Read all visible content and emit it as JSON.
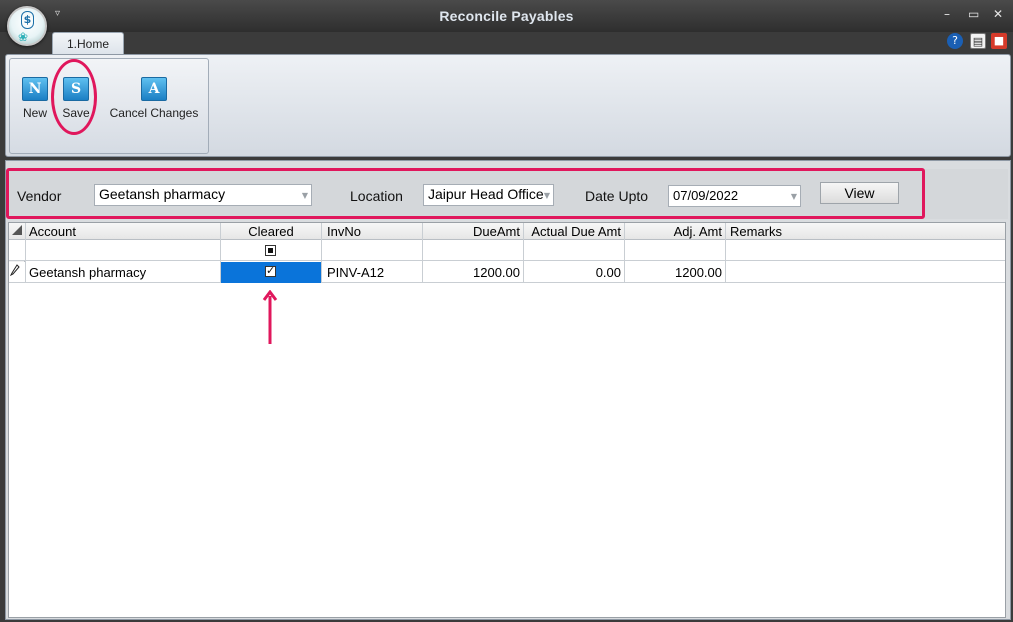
{
  "window": {
    "title": "Reconcile Payables",
    "minimize": "–",
    "restore": "▭",
    "close": "✕"
  },
  "tabs": [
    {
      "label": "1.Home"
    }
  ],
  "ribbon": {
    "buttons": [
      {
        "label": "New",
        "icon": "N"
      },
      {
        "label": "Save",
        "icon": "S"
      },
      {
        "label": "Cancel Changes",
        "icon": "A"
      }
    ]
  },
  "filters": {
    "vendor_label": "Vendor",
    "vendor_value": "Geetansh pharmacy",
    "location_label": "Location",
    "location_value": "Jaipur Head Office",
    "date_label": "Date Upto",
    "date_value": "07/09/2022",
    "view_label": "View"
  },
  "grid": {
    "columns": [
      "Account",
      "Cleared",
      "InvNo",
      "DueAmt",
      "Actual Due Amt",
      "Adj. Amt",
      "Remarks"
    ],
    "rows": [
      {
        "account": "Geetansh pharmacy",
        "cleared": true,
        "invno": "PINV-A12",
        "dueamt": "1200.00",
        "actual_due_amt": "0.00",
        "adj_amt": "1200.00",
        "remarks": ""
      }
    ]
  },
  "colors": {
    "highlight": "#e0175c",
    "selection": "#0a74da"
  }
}
